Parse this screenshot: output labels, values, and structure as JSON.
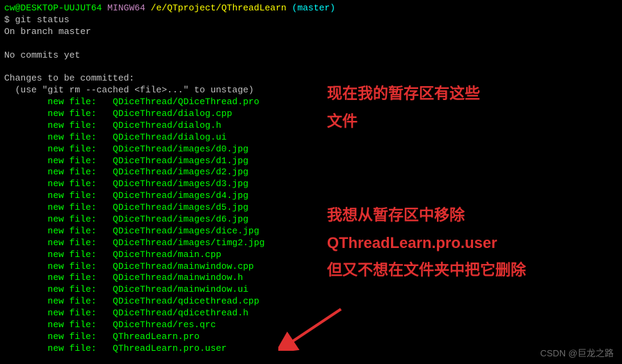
{
  "prompt": {
    "user_host": "cw@DESKTOP-UUJUT64",
    "env": "MINGW64",
    "path": "/e/QTproject/QThreadLearn",
    "branch": "(master)"
  },
  "command_prefix": "$ ",
  "command": "git status",
  "branch_line": "On branch master",
  "no_commits": "No commits yet",
  "changes_header": "Changes to be committed:",
  "unstage_hint": "  (use \"git rm --cached <file>...\" to unstage)",
  "file_label": "new file:",
  "files": [
    "QDiceThread/QDiceThread.pro",
    "QDiceThread/dialog.cpp",
    "QDiceThread/dialog.h",
    "QDiceThread/dialog.ui",
    "QDiceThread/images/d0.jpg",
    "QDiceThread/images/d1.jpg",
    "QDiceThread/images/d2.jpg",
    "QDiceThread/images/d3.jpg",
    "QDiceThread/images/d4.jpg",
    "QDiceThread/images/d5.jpg",
    "QDiceThread/images/d6.jpg",
    "QDiceThread/images/dice.jpg",
    "QDiceThread/images/timg2.jpg",
    "QDiceThread/main.cpp",
    "QDiceThread/mainwindow.cpp",
    "QDiceThread/mainwindow.h",
    "QDiceThread/mainwindow.ui",
    "QDiceThread/qdicethread.cpp",
    "QDiceThread/qdicethread.h",
    "QDiceThread/res.qrc",
    "QThreadLearn.pro",
    "QThreadLearn.pro.user"
  ],
  "annotation1_line1": "现在我的暂存区有这些",
  "annotation1_line2": "文件",
  "annotation2_line1": "我想从暂存区中移除",
  "annotation2_line2": "QThreadLearn.pro.user",
  "annotation2_line3": "但又不想在文件夹中把它删除",
  "watermark": "CSDN @巨龙之路"
}
